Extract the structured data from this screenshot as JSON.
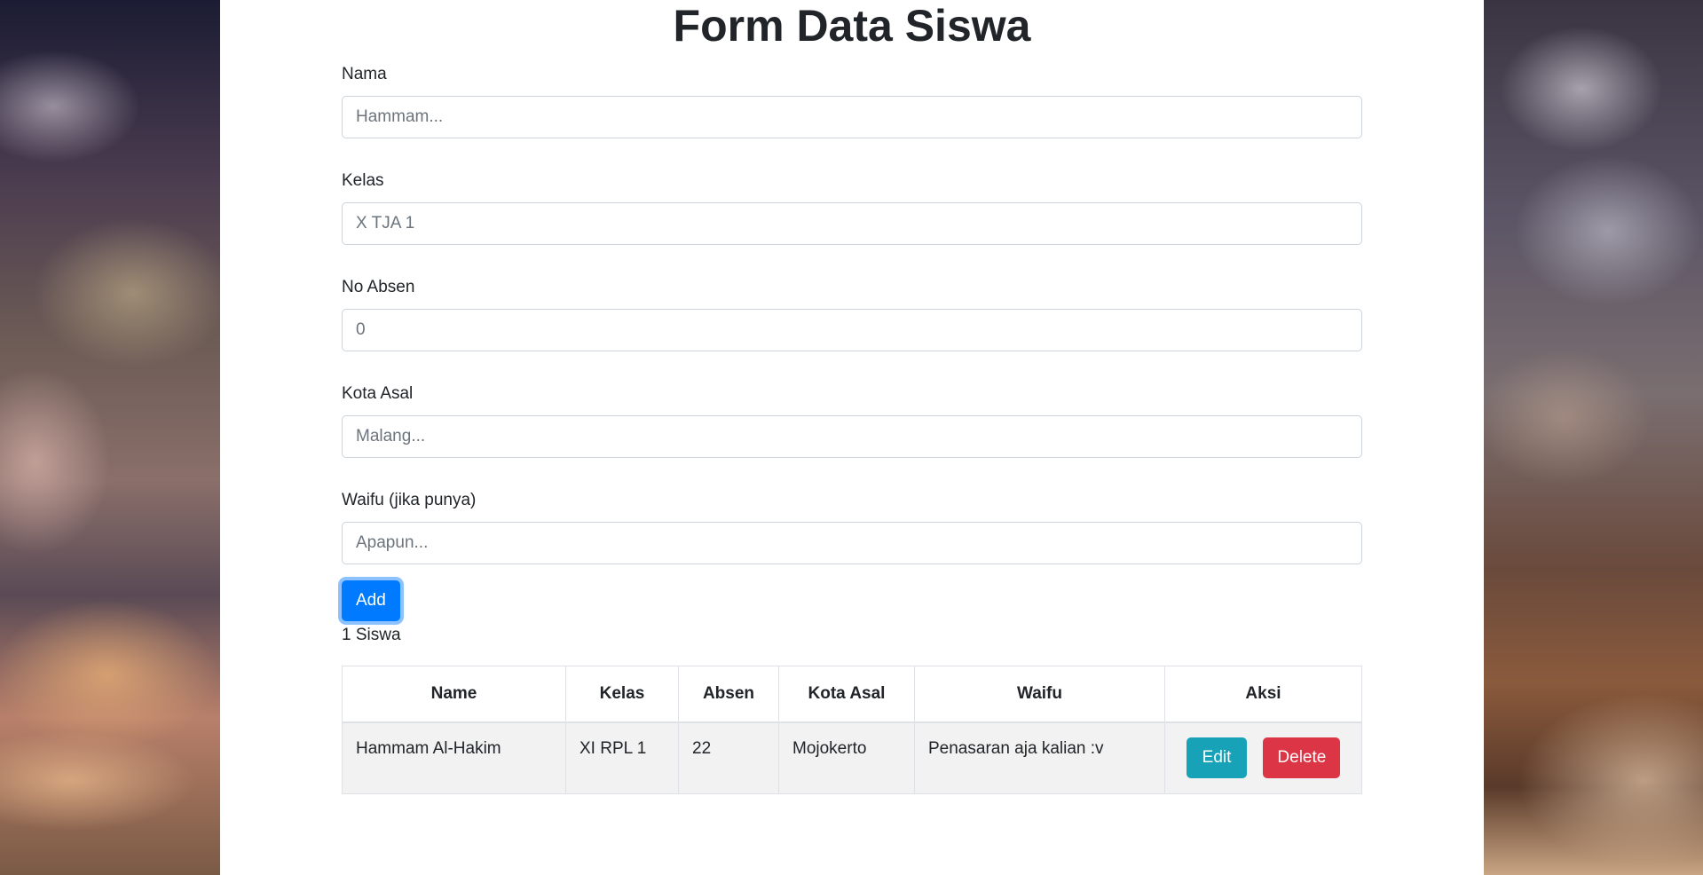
{
  "title": "Form Data Siswa",
  "fields": [
    {
      "label": "Nama",
      "placeholder": "Hammam...",
      "value": ""
    },
    {
      "label": "Kelas",
      "placeholder": "X TJA 1",
      "value": ""
    },
    {
      "label": "No Absen",
      "placeholder": "0",
      "value": ""
    },
    {
      "label": "Kota Asal",
      "placeholder": "Malang...",
      "value": ""
    },
    {
      "label": "Waifu (jika punya)",
      "placeholder": "Apapun...",
      "value": ""
    }
  ],
  "add_button": "Add",
  "count_text": "1 Siswa",
  "table": {
    "headers": [
      "Name",
      "Kelas",
      "Absen",
      "Kota Asal",
      "Waifu",
      "Aksi"
    ],
    "rows": [
      {
        "name": "Hammam Al-Hakim",
        "kelas": "XI RPL 1",
        "absen": "22",
        "kota": "Mojokerto",
        "waifu": "Penasaran aja kalian :v"
      }
    ],
    "edit_label": "Edit",
    "delete_label": "Delete"
  },
  "colors": {
    "primary": "#007bff",
    "info": "#17a2b8",
    "danger": "#dc3545"
  }
}
